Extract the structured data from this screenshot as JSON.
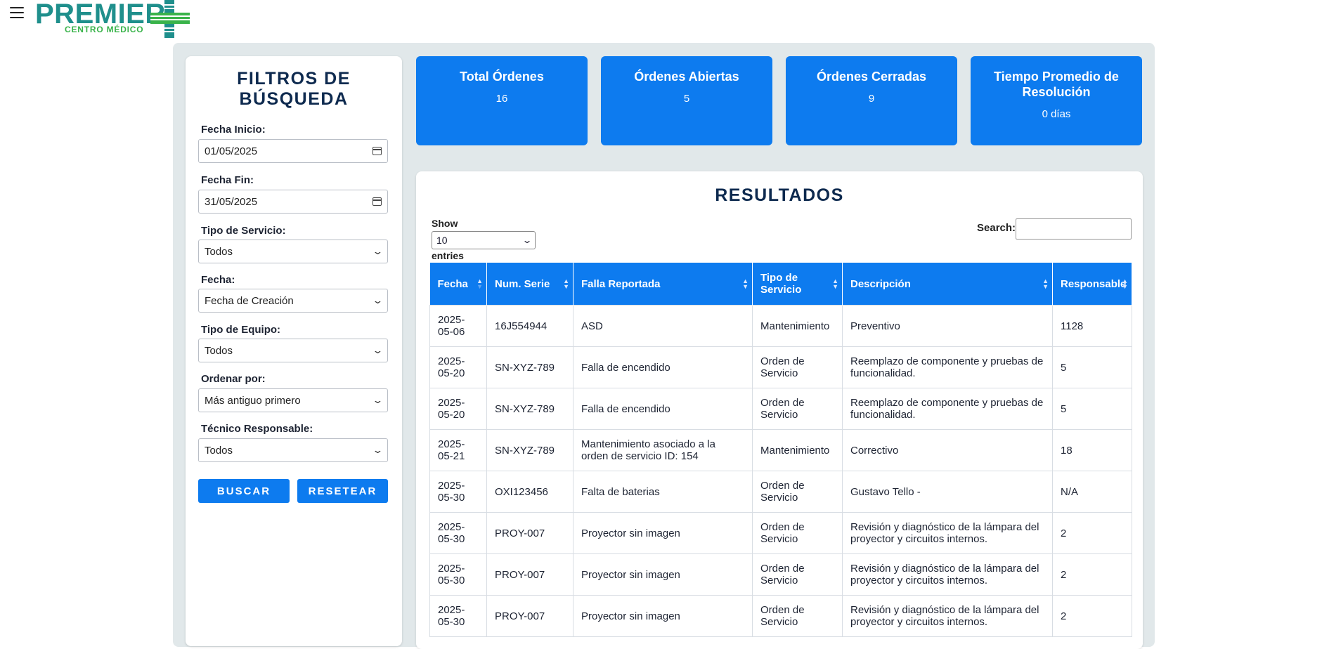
{
  "header": {
    "logo_main": "PREMIER",
    "logo_sub": "CENTRO MÉDICO"
  },
  "sidebar": {
    "title": "FILTROS DE BÚSQUEDA",
    "fecha_inicio_label": "Fecha Inicio:",
    "fecha_inicio_value": "01/05/2025",
    "fecha_fin_label": "Fecha Fin:",
    "fecha_fin_value": "31/05/2025",
    "tipo_servicio_label": "Tipo de Servicio:",
    "tipo_servicio_value": "Todos",
    "fecha_label": "Fecha:",
    "fecha_value": "Fecha de Creación",
    "tipo_equipo_label": "Tipo de Equipo:",
    "tipo_equipo_value": "Todos",
    "ordenar_label": "Ordenar por:",
    "ordenar_value": "Más antiguo primero",
    "tecnico_label": "Técnico Responsable:",
    "tecnico_value": "Todos",
    "buscar_label": "BUSCAR",
    "resetear_label": "RESETEAR"
  },
  "stats": [
    {
      "title": "Total Órdenes",
      "value": "16"
    },
    {
      "title": "Órdenes Abiertas",
      "value": "5"
    },
    {
      "title": "Órdenes Cerradas",
      "value": "9"
    },
    {
      "title": "Tiempo Promedio de Resolución",
      "value": "0 días"
    }
  ],
  "results": {
    "title": "RESULTADOS",
    "show_label": "Show",
    "show_value": "10",
    "entries_label": "entries",
    "search_label": "Search:",
    "columns": [
      "Fecha",
      "Num. Serie",
      "Falla Reportada",
      "Tipo de Servicio",
      "Descripción",
      "Responsable"
    ],
    "rows": [
      [
        "2025-05-06",
        "16J554944",
        "ASD",
        "Mantenimiento",
        "Preventivo",
        "1128"
      ],
      [
        "2025-05-20",
        "SN-XYZ-789",
        "Falla de encendido",
        "Orden de Servicio",
        "Reemplazo de componente y pruebas de funcionalidad.",
        "5"
      ],
      [
        "2025-05-20",
        "SN-XYZ-789",
        "Falla de encendido",
        "Orden de Servicio",
        "Reemplazo de componente y pruebas de funcionalidad.",
        "5"
      ],
      [
        "2025-05-21",
        "SN-XYZ-789",
        "Mantenimiento asociado a la orden de servicio ID: 154",
        "Mantenimiento",
        "Correctivo",
        "18"
      ],
      [
        "2025-05-30",
        "OXI123456",
        "Falta de baterias",
        "Orden de Servicio",
        "Gustavo Tello -",
        "N/A"
      ],
      [
        "2025-05-30",
        "PROY-007",
        "Proyector sin imagen",
        "Orden de Servicio",
        "Revisión y diagnóstico de la lámpara del proyector y circuitos internos.",
        "2"
      ],
      [
        "2025-05-30",
        "PROY-007",
        "Proyector sin imagen",
        "Orden de Servicio",
        "Revisión y diagnóstico de la lámpara del proyector y circuitos internos.",
        "2"
      ],
      [
        "2025-05-30",
        "PROY-007",
        "Proyector sin imagen",
        "Orden de Servicio",
        "Revisión y diagnóstico de la lámpara del proyector y circuitos internos.",
        "2"
      ]
    ]
  },
  "colors": {
    "accent": "#0d7bef",
    "title": "#0e2a4f",
    "panel_bg": "#e1e8ea",
    "logo_teal": "#1f8f8c",
    "logo_green": "#39b34a"
  }
}
